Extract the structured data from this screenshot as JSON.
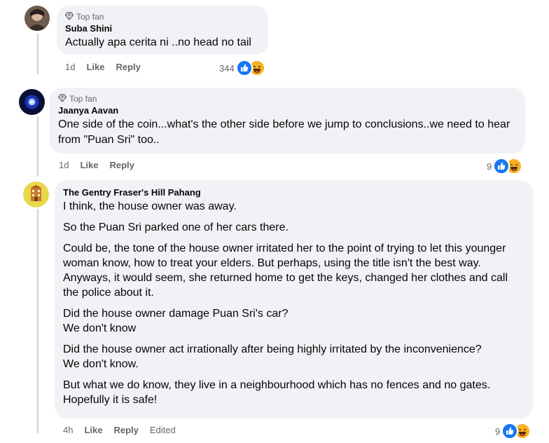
{
  "comments": [
    {
      "badge": "Top fan",
      "author": "Suba Shini",
      "paragraphs": [
        "Actually apa cerita ni ..no head no tail"
      ],
      "time": "1d",
      "like_label": "Like",
      "reply_label": "Reply",
      "reaction_count": "344",
      "reactions": [
        "like-icon",
        "haha-icon"
      ]
    },
    {
      "badge": "Top fan",
      "author": "Jaanya Aavan",
      "paragraphs": [
        "One side of the coin...what's the other side before we jump to conclusions..we need to hear from \"Puan Sri\" too.."
      ],
      "time": "1d",
      "like_label": "Like",
      "reply_label": "Reply",
      "reaction_count": "9",
      "reactions": [
        "like-icon",
        "haha-icon"
      ]
    },
    {
      "author": "The Gentry Fraser's Hill Pahang",
      "paragraphs": [
        "I think, the house owner was away.",
        "So the Puan Sri parked one of her cars there.",
        "Could be, the tone of the house owner irritated her to the point of trying to let this younger woman know, how to treat your elders. But perhaps, using the title isn't the best way. Anyways, it would seem, she returned home to get the keys, changed her clothes and call the police about it.",
        "Did the house owner damage Puan Sri's car?\nWe don't know",
        "Did the house owner act irrationally after being highly irritated by the inconvenience?\nWe don't know.",
        "But what we do know, they live in a neighbourhood which has no fences and no gates. Hopefully it is safe!"
      ],
      "time": "4h",
      "like_label": "Like",
      "reply_label": "Reply",
      "edited_label": "Edited",
      "reaction_count": "9",
      "reactions": [
        "like-icon",
        "haha-icon"
      ]
    }
  ],
  "colors": {
    "bubble": "#f0f2f5",
    "meta_text": "#65676b",
    "like_blue": "#1877f2",
    "haha_yellow": "#f7b125"
  }
}
